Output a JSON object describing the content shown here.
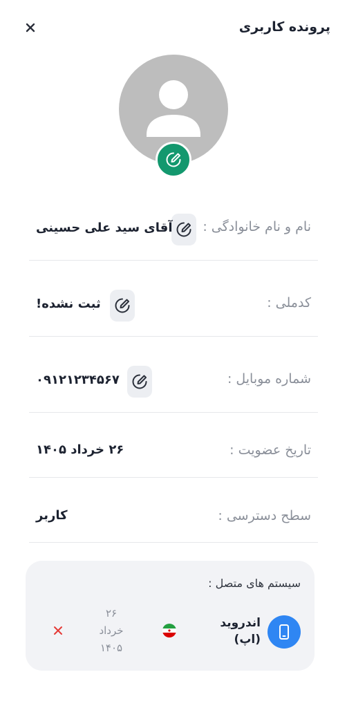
{
  "header": {
    "title": "پرونده کاربری"
  },
  "profile": {
    "fields": [
      {
        "label": "نام و نام خانوادگی :",
        "value": "آقای سید علی حسینی"
      },
      {
        "label": "کدملی :",
        "value": "ثبت نشده!"
      },
      {
        "label": "شماره موبایل :",
        "value": "۰۹۱۲۱۲۳۴۵۶۷"
      },
      {
        "label": "تاریخ عضویت :",
        "value": "۲۶ خرداد ۱۴۰۵"
      },
      {
        "label": "سطح دسترسی :",
        "value": "کاربر"
      }
    ]
  },
  "connected_systems": {
    "title": "سیستم های متصل :",
    "devices": [
      {
        "name_line1": "اندروید",
        "name_line2": "(اپ)",
        "date_day": "۲۶",
        "date_month": "خرداد",
        "date_year": "۱۴۰۵"
      }
    ]
  },
  "colors": {
    "accent_green": "#13986e",
    "accent_blue": "#2f86f3",
    "remove_red": "#e53935"
  },
  "icons": {
    "close": "close-icon",
    "avatar": "user-silhouette-icon",
    "edit": "pencil-edit-icon",
    "phone": "smartphone-icon",
    "flag": "iran-flag-icon",
    "remove": "remove-x-icon"
  }
}
